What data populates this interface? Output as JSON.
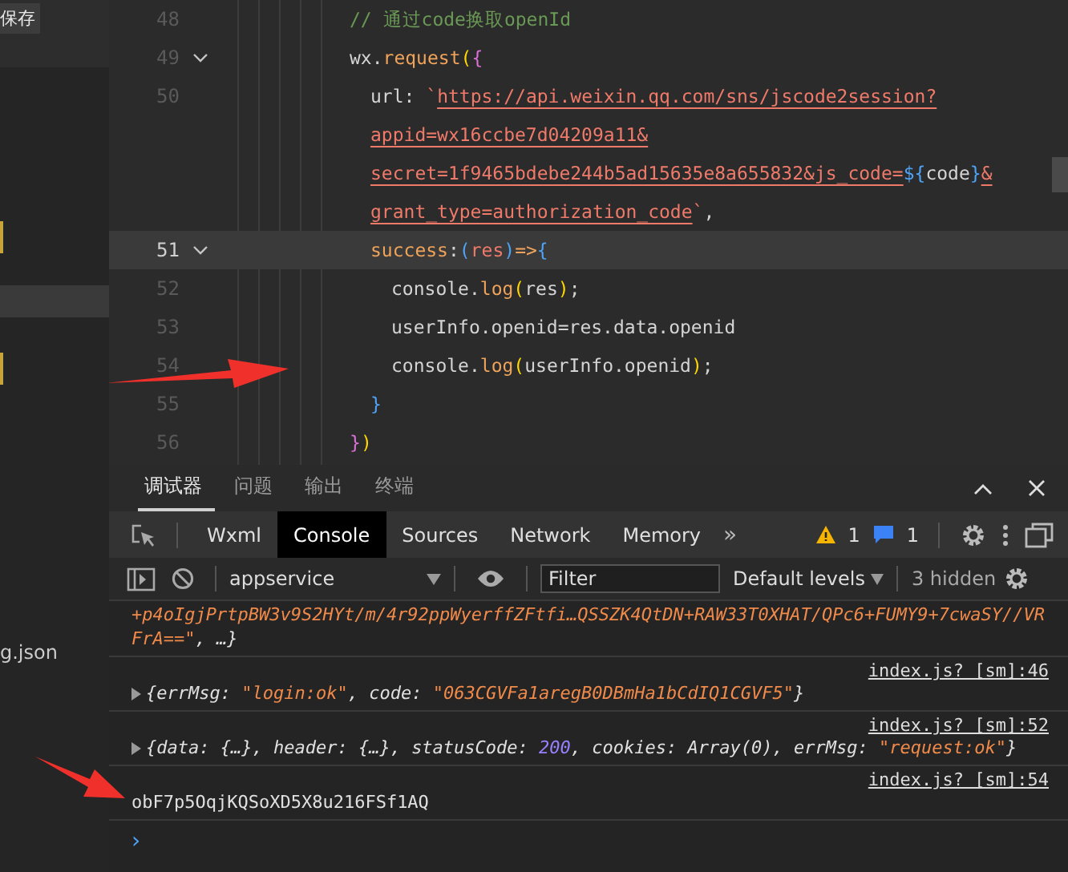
{
  "sidebar": {
    "save_label": "保存",
    "file_label": "g.json",
    "items": [
      {
        "selected": false
      },
      {
        "selected": true
      },
      {
        "selected": false
      }
    ]
  },
  "editor": {
    "lines": [
      {
        "number": "48",
        "fold": false,
        "highlighted": false,
        "kind": "top",
        "tokens": [
          {
            "kind": "comment",
            "text": "// 通过code换取openId"
          }
        ]
      },
      {
        "number": "49",
        "fold": true,
        "highlighted": false,
        "kind": "top",
        "tokens": [
          {
            "kind": "plain",
            "text": "wx."
          },
          {
            "kind": "method",
            "text": "request"
          },
          {
            "kind": "bracket1",
            "text": "("
          },
          {
            "kind": "bracket2",
            "text": "{"
          }
        ]
      },
      {
        "number": "50",
        "fold": false,
        "highlighted": false,
        "kind": "nested",
        "tokens": [
          {
            "kind": "plain",
            "text": "url: "
          },
          {
            "kind": "string",
            "text": "`"
          },
          {
            "kind": "link",
            "text": "https://api.weixin.qq.com/sns/jscode2session?"
          }
        ]
      },
      {
        "fold": false,
        "highlighted": false,
        "kind": "nested",
        "tokens": [
          {
            "kind": "link",
            "text": "appid=wx16ccbe7d04209a11&"
          }
        ]
      },
      {
        "fold": false,
        "highlighted": false,
        "kind": "nested",
        "tokens": [
          {
            "kind": "link",
            "text": "secret=1f9465bdebe244b5ad15635e8a655832&js_code="
          },
          {
            "kind": "bracket3",
            "text": "${"
          },
          {
            "kind": "plain",
            "text": "code"
          },
          {
            "kind": "bracket3",
            "text": "}"
          },
          {
            "kind": "link",
            "text": "&"
          }
        ]
      },
      {
        "fold": false,
        "highlighted": false,
        "kind": "nested",
        "tokens": [
          {
            "kind": "link",
            "text": "grant_type=authorization_code"
          },
          {
            "kind": "string",
            "text": "`"
          },
          {
            "kind": "plain",
            "text": ","
          }
        ]
      },
      {
        "number": "51",
        "fold": true,
        "highlighted": true,
        "kind": "nested",
        "tokens": [
          {
            "kind": "method",
            "text": "success"
          },
          {
            "kind": "plain",
            "text": ":"
          },
          {
            "kind": "bracket3",
            "text": "("
          },
          {
            "kind": "param",
            "text": "res"
          },
          {
            "kind": "bracket3",
            "text": ")"
          },
          {
            "kind": "method",
            "text": "=>"
          },
          {
            "kind": "bracket3",
            "text": "{"
          }
        ]
      },
      {
        "number": "52",
        "fold": false,
        "highlighted": false,
        "kind": "inner",
        "tokens": [
          {
            "kind": "plain",
            "text": "console."
          },
          {
            "kind": "method",
            "text": "log"
          },
          {
            "kind": "bracket1",
            "text": "("
          },
          {
            "kind": "plain",
            "text": "res"
          },
          {
            "kind": "bracket1",
            "text": ")"
          },
          {
            "kind": "plain",
            "text": ";"
          }
        ]
      },
      {
        "number": "53",
        "fold": false,
        "highlighted": false,
        "kind": "inner",
        "tokens": [
          {
            "kind": "plain",
            "text": "userInfo.openid=res.data.openid"
          }
        ]
      },
      {
        "number": "54",
        "fold": false,
        "highlighted": false,
        "kind": "inner",
        "tokens": [
          {
            "kind": "plain",
            "text": "console."
          },
          {
            "kind": "method",
            "text": "log"
          },
          {
            "kind": "bracket1",
            "text": "("
          },
          {
            "kind": "plain",
            "text": "userInfo.openid"
          },
          {
            "kind": "bracket1",
            "text": ")"
          },
          {
            "kind": "plain",
            "text": ";"
          }
        ]
      },
      {
        "number": "55",
        "fold": false,
        "highlighted": false,
        "kind": "nested",
        "tokens": [
          {
            "kind": "bracket3",
            "text": "}"
          }
        ]
      },
      {
        "number": "56",
        "fold": false,
        "highlighted": false,
        "kind": "top",
        "tokens": [
          {
            "kind": "bracket2",
            "text": "}"
          },
          {
            "kind": "bracket1",
            "text": ")"
          }
        ]
      }
    ]
  },
  "panel_tabs": [
    {
      "label": "调试器",
      "selected": true
    },
    {
      "label": "问题",
      "selected": false
    },
    {
      "label": "输出",
      "selected": false
    },
    {
      "label": "终端",
      "selected": false
    }
  ],
  "devtools_tabs": [
    {
      "label": "Wxml",
      "selected": false
    },
    {
      "label": "Console",
      "selected": true
    },
    {
      "label": "Sources",
      "selected": false
    },
    {
      "label": "Network",
      "selected": false
    },
    {
      "label": "Memory",
      "selected": false
    }
  ],
  "more_tabs": "»",
  "warning_count": "1",
  "message_count": "1",
  "console_toolbar": {
    "context": "appservice",
    "filter": {
      "placeholder": "Filter"
    },
    "levels": "Default levels",
    "hidden": "3 hidden"
  },
  "logs": [
    {
      "expandable": false,
      "tokens": [
        {
          "kind": "string",
          "text": "+p4oIgjPrtpBW3v9S2HYt/m/4r92ppWyerffZFtfi…QSSZK4QtDN+RAW33T0XHAT/QPc6+FUMY9+7cwaSY//VRFrA==\""
        },
        {
          "kind": "key",
          "text": ", …}"
        }
      ]
    },
    {
      "source": "index.js? [sm]:46",
      "expandable": true,
      "tokens": [
        {
          "kind": "key",
          "text": "{errMsg: "
        },
        {
          "kind": "string",
          "text": "\"login:ok\""
        },
        {
          "kind": "key",
          "text": ", code: "
        },
        {
          "kind": "string",
          "text": "\"063CGVFa1aregB0DBmHa1bCdIQ1CGVF5\""
        },
        {
          "kind": "key",
          "text": "}"
        }
      ]
    },
    {
      "source": "index.js? [sm]:52",
      "expandable": true,
      "tokens": [
        {
          "kind": "key",
          "text": "{data: {…}, header: {…}, statusCode: "
        },
        {
          "kind": "number",
          "text": "200"
        },
        {
          "kind": "key",
          "text": ", cookies: Array(0), errMsg: "
        },
        {
          "kind": "string",
          "text": "\"request:ok\""
        },
        {
          "kind": "key",
          "text": "}"
        }
      ]
    },
    {
      "source": "index.js? [sm]:54",
      "expandable": false,
      "tokens": [
        {
          "kind": "value",
          "text": "obF7p5OqjKQSoXD5X8u216FSf1AQ"
        }
      ]
    }
  ],
  "prompt": "›"
}
